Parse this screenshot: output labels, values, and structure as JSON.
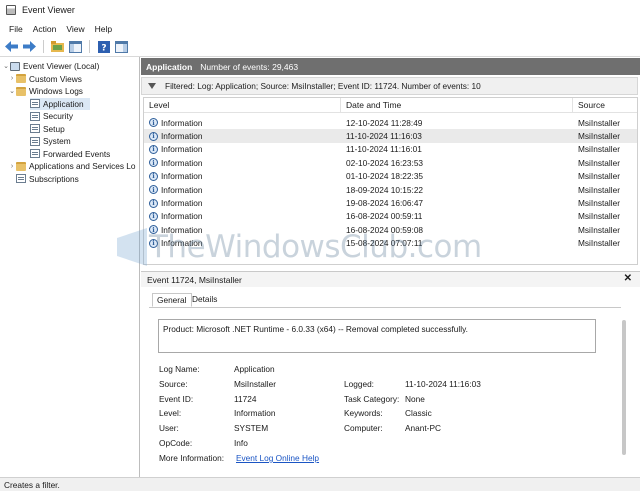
{
  "window": {
    "title": "Event Viewer"
  },
  "menu": [
    "File",
    "Action",
    "View",
    "Help"
  ],
  "toolbar": [
    "back-arrow-icon",
    "forward-arrow-icon",
    "folder-icon",
    "console-tree-icon",
    "help-icon",
    "action-pane-icon"
  ],
  "tree": {
    "items": [
      {
        "label": "Event Viewer (Local)",
        "icon": "computer-icon",
        "twisty": "⌄",
        "indent": 0
      },
      {
        "label": "Custom Views",
        "icon": "folder-icon",
        "twisty": "›",
        "indent": 1
      },
      {
        "label": "Windows Logs",
        "icon": "folder-icon",
        "twisty": "⌄",
        "indent": 1
      },
      {
        "label": "Application",
        "icon": "log-icon",
        "twisty": "",
        "indent": 2,
        "selected": true
      },
      {
        "label": "Security",
        "icon": "log-icon",
        "twisty": "",
        "indent": 2
      },
      {
        "label": "Setup",
        "icon": "log-icon",
        "twisty": "",
        "indent": 2
      },
      {
        "label": "System",
        "icon": "log-icon",
        "twisty": "",
        "indent": 2
      },
      {
        "label": "Forwarded Events",
        "icon": "log-icon",
        "twisty": "",
        "indent": 2
      },
      {
        "label": "Applications and Services Lo",
        "icon": "folder-icon",
        "twisty": "›",
        "indent": 1
      },
      {
        "label": "Subscriptions",
        "icon": "log-icon",
        "twisty": "",
        "indent": 1
      }
    ]
  },
  "header": {
    "title": "Application",
    "count": "Number of events: 29,463"
  },
  "filter": {
    "text": "Filtered: Log: Application; Source: MsiInstaller; Event ID: 11724. Number of events: 10"
  },
  "events": {
    "columns": [
      "Level",
      "Date and Time",
      "Source"
    ],
    "rows": [
      {
        "level": "Information",
        "date": "12-10-2024 11:28:49",
        "source": "MsiInstaller"
      },
      {
        "level": "Information",
        "date": "11-10-2024 11:16:03",
        "source": "MsiInstaller",
        "selected": true
      },
      {
        "level": "Information",
        "date": "11-10-2024 11:16:01",
        "source": "MsiInstaller"
      },
      {
        "level": "Information",
        "date": "02-10-2024 16:23:53",
        "source": "MsiInstaller"
      },
      {
        "level": "Information",
        "date": "01-10-2024 18:22:35",
        "source": "MsiInstaller"
      },
      {
        "level": "Information",
        "date": "18-09-2024 10:15:22",
        "source": "MsiInstaller"
      },
      {
        "level": "Information",
        "date": "19-08-2024 16:06:47",
        "source": "MsiInstaller"
      },
      {
        "level": "Information",
        "date": "16-08-2024 00:59:11",
        "source": "MsiInstaller"
      },
      {
        "level": "Information",
        "date": "16-08-2024 00:59:08",
        "source": "MsiInstaller"
      },
      {
        "level": "Information",
        "date": "15-08-2024 07:07:11",
        "source": "MsiInstaller"
      }
    ]
  },
  "watermark": {
    "text": "TheWindowsClub.com"
  },
  "details": {
    "title": "Event 11724, MsiInstaller",
    "tabs": [
      "General",
      "Details"
    ],
    "description": "Product: Microsoft .NET Runtime - 6.0.33 (x64) -- Removal completed successfully.",
    "fields": {
      "log_name": {
        "label": "Log Name:",
        "value": "Application"
      },
      "source": {
        "label": "Source:",
        "value": "MsiInstaller"
      },
      "logged": {
        "label": "Logged:",
        "value": "11-10-2024 11:16:03"
      },
      "event_id": {
        "label": "Event ID:",
        "value": "11724"
      },
      "task_category": {
        "label": "Task Category:",
        "value": "None"
      },
      "level": {
        "label": "Level:",
        "value": "Information"
      },
      "keywords": {
        "label": "Keywords:",
        "value": "Classic"
      },
      "user": {
        "label": "User:",
        "value": "SYSTEM"
      },
      "computer": {
        "label": "Computer:",
        "value": "Anant-PC"
      },
      "opcode": {
        "label": "OpCode:",
        "value": "Info"
      },
      "more_info": {
        "label": "More Information:",
        "value": "Event Log Online Help"
      }
    }
  },
  "status": {
    "text": "Creates a filter."
  },
  "colors": {
    "header_bg": "#6f6f6f",
    "selected_row": "#eaeaea",
    "tree_selected": "#dbe8f5",
    "link": "#1a55c4"
  }
}
